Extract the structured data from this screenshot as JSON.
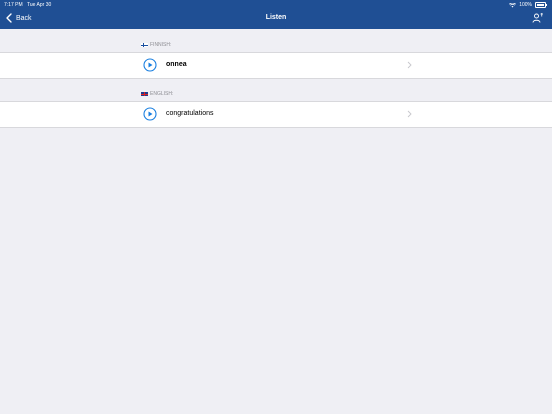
{
  "status_bar": {
    "time": "7:17 PM",
    "date": "Tue Apr 30",
    "battery": "100%"
  },
  "nav": {
    "back_label": "Back",
    "title": "Listen"
  },
  "sections": [
    {
      "language": "FINNISH:",
      "flag": "finland-flag-icon",
      "word": "onnea"
    },
    {
      "language": "ENGLISH:",
      "flag": "uk-flag-icon",
      "word": "congratulations"
    }
  ],
  "colors": {
    "nav_bg": "#1f4f94",
    "accent": "#1a7fe0",
    "page_bg": "#efeff4"
  }
}
